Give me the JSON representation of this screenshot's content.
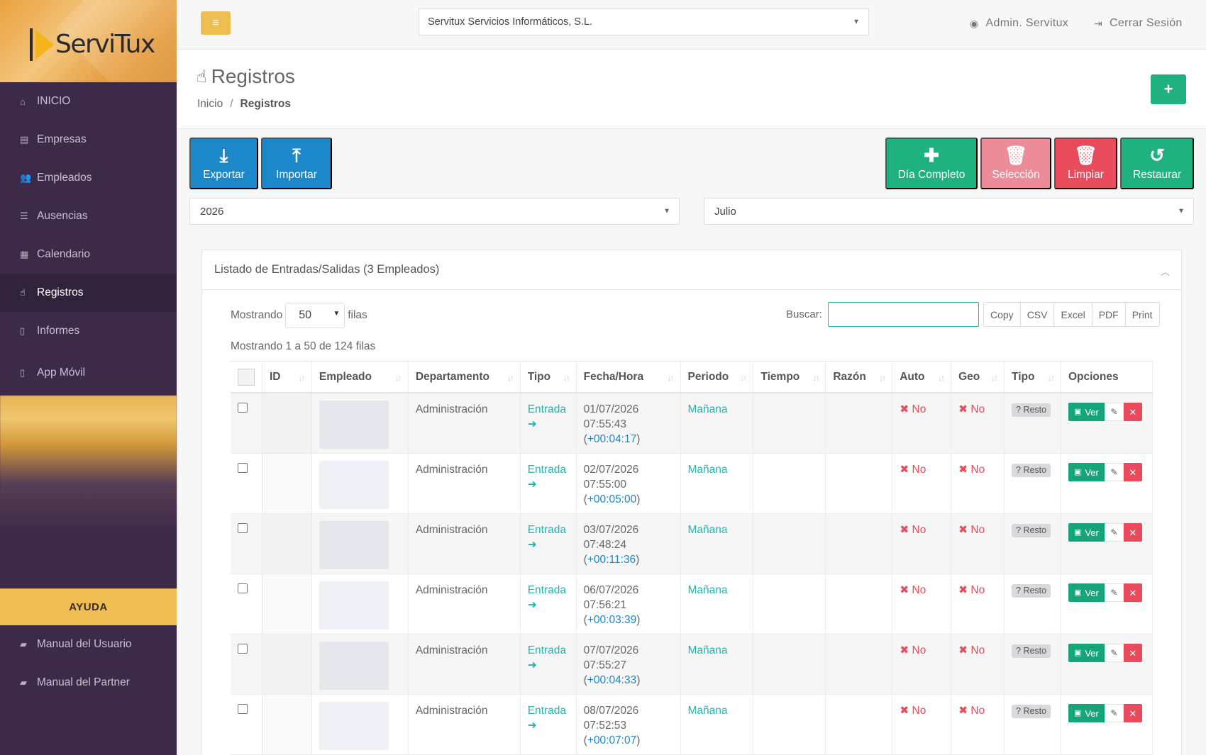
{
  "app": {
    "brand": "ServiTux",
    "company": "Servitux Servicios Informáticos, S.L."
  },
  "header": {
    "user_label": "Admin. Servitux",
    "logout_label": "Cerrar Sesión"
  },
  "sidebar": {
    "items": [
      {
        "label": "INICIO",
        "icon": "home-icon"
      },
      {
        "label": "Empresas",
        "icon": "building-icon"
      },
      {
        "label": "Empleados",
        "icon": "users-icon"
      },
      {
        "label": "Ausencias",
        "icon": "list-icon"
      },
      {
        "label": "Calendario",
        "icon": "calendar-icon"
      },
      {
        "label": "Registros",
        "icon": "hand-pointer-icon"
      },
      {
        "label": "Informes",
        "icon": "file-icon"
      },
      {
        "label": "App Móvil",
        "icon": "mobile-icon"
      }
    ],
    "help_label": "AYUDA",
    "manuals": [
      {
        "label": "Manual del Usuario",
        "icon": "book-icon"
      },
      {
        "label": "Manual del Partner",
        "icon": "book-icon"
      }
    ]
  },
  "page": {
    "title": "Registros",
    "breadcrumb_home": "Inicio",
    "breadcrumb_sep": "/",
    "breadcrumb_current": "Registros",
    "add_label": "+"
  },
  "actions": {
    "export": "Exportar",
    "import": "Importar",
    "full_day": "Día Completo",
    "selection": "Selección",
    "clear": "Limpiar",
    "restore": "Restaurar"
  },
  "filters": {
    "year": "2026",
    "month": "Julio"
  },
  "panel": {
    "title": "Listado de Entradas/Salidas (3 Empleados)",
    "showing_label": "Mostrando",
    "rows_value": "50",
    "rows_suffix": "filas",
    "search_label": "Buscar:",
    "export_buttons": [
      "Copy",
      "CSV",
      "Excel",
      "PDF",
      "Print"
    ],
    "count_info": "Mostrando 1 a 50 de 124 filas"
  },
  "table": {
    "columns": [
      "ID",
      "Empleado",
      "Departamento",
      "Tipo",
      "Fecha/Hora",
      "Periodo",
      "Tiempo",
      "Razón",
      "Auto",
      "Geo",
      "Tipo",
      "Opciones"
    ],
    "rows": [
      {
        "dept": "Administración",
        "tipo": "Entrada",
        "date": "01/07/2026",
        "time": "07:55:43",
        "delta": "+00:04:17",
        "periodo": "Mañana",
        "auto": "No",
        "geo": "No",
        "tipo2": "Resto",
        "ver": "Ver"
      },
      {
        "dept": "Administración",
        "tipo": "Entrada",
        "date": "02/07/2026",
        "time": "07:55:00",
        "delta": "+00:05:00",
        "periodo": "Mañana",
        "auto": "No",
        "geo": "No",
        "tipo2": "Resto",
        "ver": "Ver"
      },
      {
        "dept": "Administración",
        "tipo": "Entrada",
        "date": "03/07/2026",
        "time": "07:48:24",
        "delta": "+00:11:36",
        "periodo": "Mañana",
        "auto": "No",
        "geo": "No",
        "tipo2": "Resto",
        "ver": "Ver"
      },
      {
        "dept": "Administración",
        "tipo": "Entrada",
        "date": "06/07/2026",
        "time": "07:56:21",
        "delta": "+00:03:39",
        "periodo": "Mañana",
        "auto": "No",
        "geo": "No",
        "tipo2": "Resto",
        "ver": "Ver"
      },
      {
        "dept": "Administración",
        "tipo": "Entrada",
        "date": "07/07/2026",
        "time": "07:55:27",
        "delta": "+00:04:33",
        "periodo": "Mañana",
        "auto": "No",
        "geo": "No",
        "tipo2": "Resto",
        "ver": "Ver"
      },
      {
        "dept": "Administración",
        "tipo": "Entrada",
        "date": "08/07/2026",
        "time": "07:52:53",
        "delta": "+00:07:07",
        "periodo": "Mañana",
        "auto": "No",
        "geo": "No",
        "tipo2": "Resto",
        "ver": "Ver"
      }
    ]
  },
  "colors": {
    "sidebar_bg": "#3c2a48",
    "accent_yellow": "#efbe52",
    "green": "#1fb17e",
    "blue": "#1c87c9",
    "red": "#e94b5c",
    "teal": "#23b5b0"
  }
}
